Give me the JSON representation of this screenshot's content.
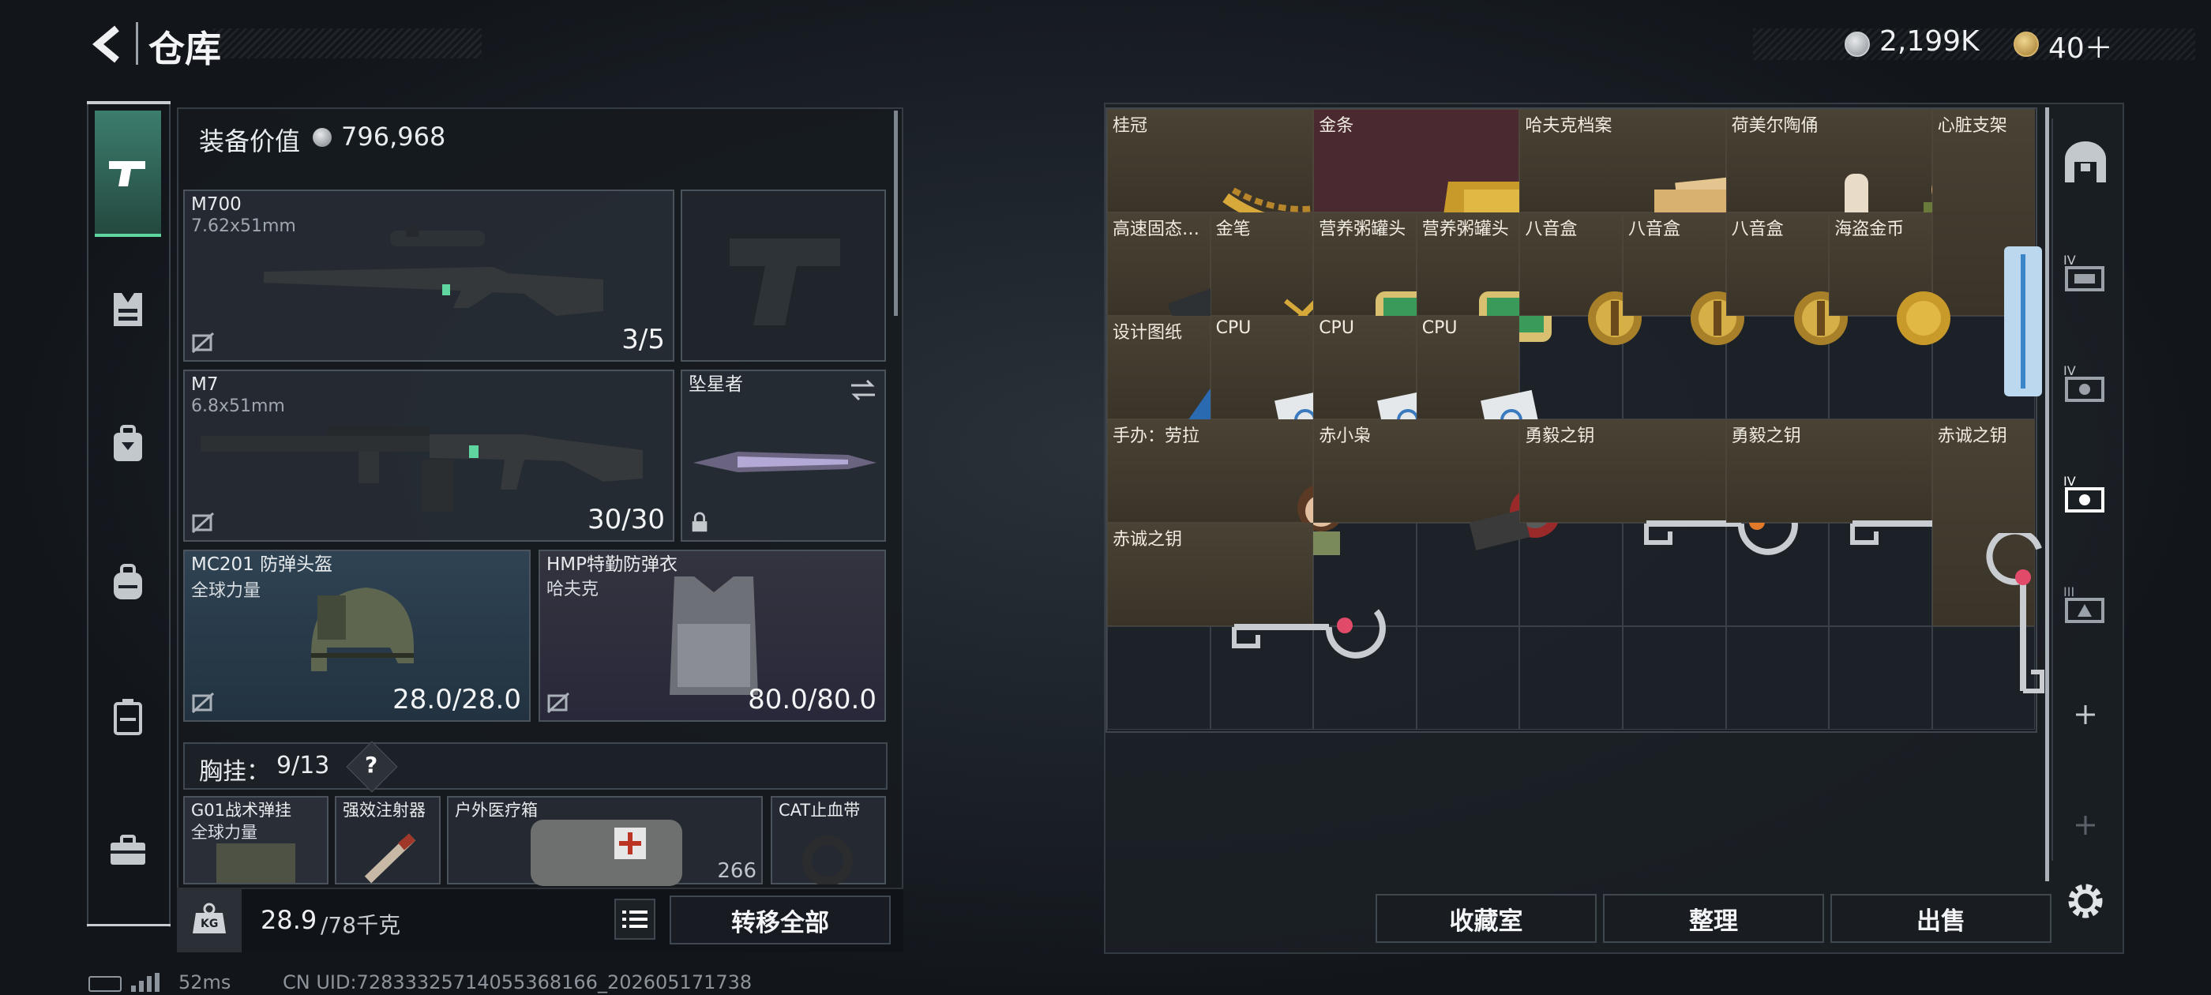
{
  "header": {
    "title": "仓库",
    "currency1": "2,199K",
    "currency2": "40＋"
  },
  "equipment": {
    "value_label": "装备价值",
    "value": "796,968",
    "primary1": {
      "name": "M700",
      "caliber": "7.62x51mm",
      "ammo": "3/5"
    },
    "primary2": {
      "name": "M7",
      "caliber": "6.8x51mm",
      "ammo": "30/30"
    },
    "melee": {
      "name": "坠星者"
    },
    "helmet": {
      "name": "MC201 防弹头盔",
      "sub": "全球力量",
      "durability": "28.0/28.0"
    },
    "armor": {
      "name": "HMP特勤防弹衣",
      "sub": "哈夫克",
      "durability": "80.0/80.0"
    },
    "rig": {
      "label": "胸挂：",
      "count": "9/13",
      "help": "?"
    },
    "rig_items": [
      {
        "name": "G01战术弹挂",
        "sub": "全球力量"
      },
      {
        "name": "强效注射器"
      },
      {
        "name": "户外医疗箱",
        "value": "266"
      },
      {
        "name": "CAT止血带"
      }
    ]
  },
  "footer": {
    "weight": "28.9",
    "weight_max": "/78千克",
    "transfer_all": "转移全部",
    "kg_icon": "KG"
  },
  "storage_items": [
    {
      "label": "桂冠"
    },
    {
      "label": "金条"
    },
    {
      "label": "哈夫克档案"
    },
    {
      "label": "荷美尔陶俑"
    },
    {
      "label": "心脏支架"
    },
    {
      "label": "高速固态…"
    },
    {
      "label": "金笔"
    },
    {
      "label": "营养粥罐头"
    },
    {
      "label": "营养粥罐头"
    },
    {
      "label": "八音盒"
    },
    {
      "label": "八音盒"
    },
    {
      "label": "八音盒"
    },
    {
      "label": "海盗金币"
    },
    {
      "label": "设计图纸"
    },
    {
      "label": "CPU"
    },
    {
      "label": "CPU"
    },
    {
      "label": "CPU"
    },
    {
      "label": "手办：劳拉"
    },
    {
      "label": "赤小枭"
    },
    {
      "label": "勇毅之钥"
    },
    {
      "label": "勇毅之钥"
    },
    {
      "label": "赤诚之钥"
    },
    {
      "label": "赤诚之钥"
    }
  ],
  "buttons": {
    "collection": "收藏室",
    "sort": "整理",
    "sell": "出售"
  },
  "status": {
    "ping": "52ms",
    "uid": "CN UID:7283332571405536816​6_202605171738"
  },
  "colors": {
    "gold_bar_bg": "#4a2a30",
    "item_bg": "#3f382c",
    "helmet_slot": "#2c3e4d",
    "accent_green": "#5fd6a0"
  }
}
